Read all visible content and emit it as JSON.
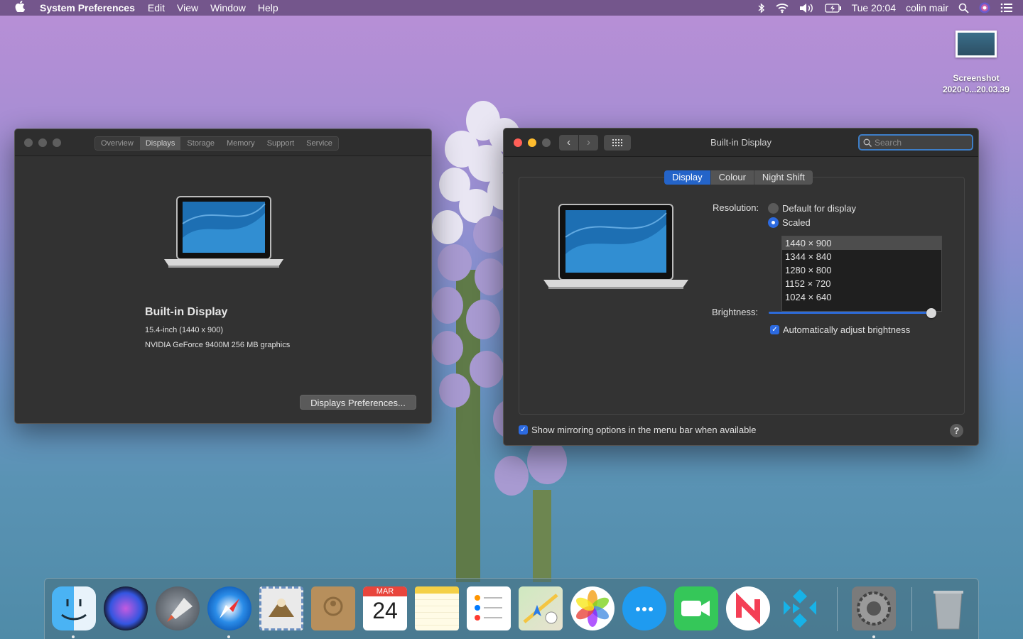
{
  "menubar": {
    "app_name": "System Preferences",
    "menus": [
      "Edit",
      "View",
      "Window",
      "Help"
    ],
    "clock": "Tue 20:04",
    "user": "colin mair"
  },
  "desktop_icon": {
    "line1": "Screenshot",
    "line2": "2020-0...20.03.39"
  },
  "about_window": {
    "tabs": [
      "Overview",
      "Displays",
      "Storage",
      "Memory",
      "Support",
      "Service"
    ],
    "selected_tab": "Displays",
    "display_name": "Built-in Display",
    "spec_size": "15.4-inch (1440 x 900)",
    "spec_graphics": "NVIDIA GeForce 9400M 256 MB graphics",
    "prefs_button": "Displays Preferences..."
  },
  "prefs_window": {
    "title": "Built-in Display",
    "search_placeholder": "Search",
    "tabs": [
      "Display",
      "Colour",
      "Night Shift"
    ],
    "selected_tab": "Display",
    "resolution_label": "Resolution:",
    "radio_default": "Default for display",
    "radio_scaled": "Scaled",
    "resolution_selected": "Scaled",
    "resolutions": [
      "1440 × 900",
      "1344 × 840",
      "1280 × 800",
      "1152 × 720",
      "1024 × 640"
    ],
    "selected_resolution": "1440 × 900",
    "brightness_label": "Brightness:",
    "brightness_level": 1.0,
    "auto_brightness": "Automatically adjust brightness",
    "auto_brightness_checked": true,
    "mirroring": "Show mirroring options in the menu bar when available",
    "mirroring_checked": true,
    "help": "?"
  },
  "dock": {
    "calendar_month": "MAR",
    "calendar_day": "24",
    "apps": [
      "finder-icon",
      "siri-icon",
      "launchpad-icon",
      "safari-icon",
      "mail-icon",
      "contacts-icon",
      "calendar-icon",
      "notes-icon",
      "reminders-icon",
      "maps-icon",
      "photos-icon",
      "messages-icon",
      "facetime-icon",
      "news-icon",
      "kodi-icon",
      "system-preferences-icon",
      "trash-icon"
    ]
  },
  "colors": {
    "accent": "#2c6ae0",
    "window_bg": "#323232"
  }
}
